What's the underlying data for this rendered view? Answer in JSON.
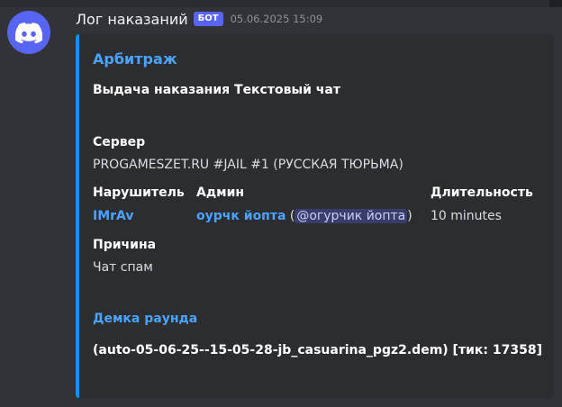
{
  "colors": {
    "background": "#323339",
    "embed_background": "#2b2d31",
    "embed_accent": "#1a8cff",
    "link": "#4aa3ff",
    "bot_tag": "#5865f2",
    "avatar": "#5865f2"
  },
  "message": {
    "avatar_icon": "discord-logo-icon",
    "author": "Лог наказаний",
    "bot_tag": "БОТ",
    "timestamp": "05.06.2025 15:09"
  },
  "embed": {
    "author": "Арбитраж",
    "title": "Выдача наказания Текстовый чат",
    "server": {
      "name": "Сервер",
      "value": "PROGAMESZET.RU #JAIL #1 (РУССКАЯ ТЮРЬМА)"
    },
    "offender": {
      "name": "Нарушитель",
      "value": "IMrAv"
    },
    "admin": {
      "name": "Админ",
      "value": "оурчк йопта",
      "paren_open": "(",
      "mention": "@огурчик йопта",
      "paren_close": ")"
    },
    "duration": {
      "name": "Длительность",
      "value": "10 minutes"
    },
    "reason": {
      "name": "Причина",
      "value": "Чат спам"
    },
    "demo": {
      "title": "Демка раунда",
      "file": "(auto-05-06-25--15-05-28-jb_casuarina_pgz2.dem) [тик: 17358]"
    }
  }
}
